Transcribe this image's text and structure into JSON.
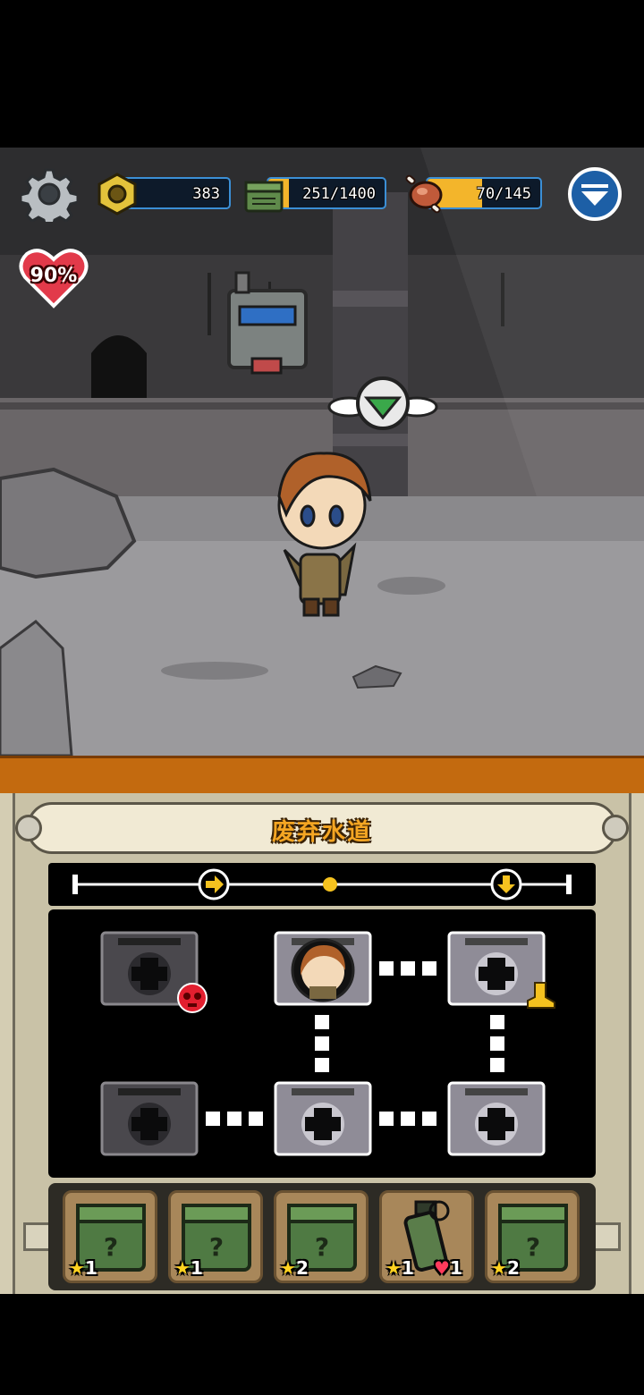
{
  "hud": {
    "gold": {
      "label": "383",
      "icon": "gold-nut-icon"
    },
    "supplies": {
      "label": "251/1400",
      "current": 251,
      "max": 1400,
      "icon": "ammo-crate-icon"
    },
    "food": {
      "label": "70/145",
      "current": 70,
      "max": 145,
      "icon": "meat-icon"
    },
    "health": {
      "label": "90%",
      "icon": "heart-icon"
    },
    "settings_icon": "gear-icon",
    "dropdown_icon": "dropdown-arrow-icon"
  },
  "level": {
    "title": "废弃水道",
    "progress_markers": [
      "start",
      "arrow-right-icon",
      "current-dot",
      "arrow-down-icon",
      "end"
    ]
  },
  "map": {
    "rooms": [
      {
        "id": "room-top-left",
        "state": "locked-enemy"
      },
      {
        "id": "room-top-center",
        "state": "player"
      },
      {
        "id": "room-top-right",
        "state": "unlocked-exit"
      },
      {
        "id": "room-bottom-left",
        "state": "locked"
      },
      {
        "id": "room-bottom-center",
        "state": "unlocked"
      },
      {
        "id": "room-bottom-right",
        "state": "unlocked"
      }
    ]
  },
  "loot": [
    {
      "item": "mystery-crate",
      "stars": "1"
    },
    {
      "item": "mystery-crate",
      "stars": "1"
    },
    {
      "item": "mystery-crate",
      "stars": "2"
    },
    {
      "item": "grenade",
      "stars": "1",
      "hearts": "1"
    },
    {
      "item": "mystery-crate",
      "stars": "2"
    }
  ],
  "colors": {
    "accent_gold": "#f3b52b",
    "bar_border": "#3b8fd6",
    "panel_orange": "#c36a0f",
    "title_text": "#f5a623"
  }
}
